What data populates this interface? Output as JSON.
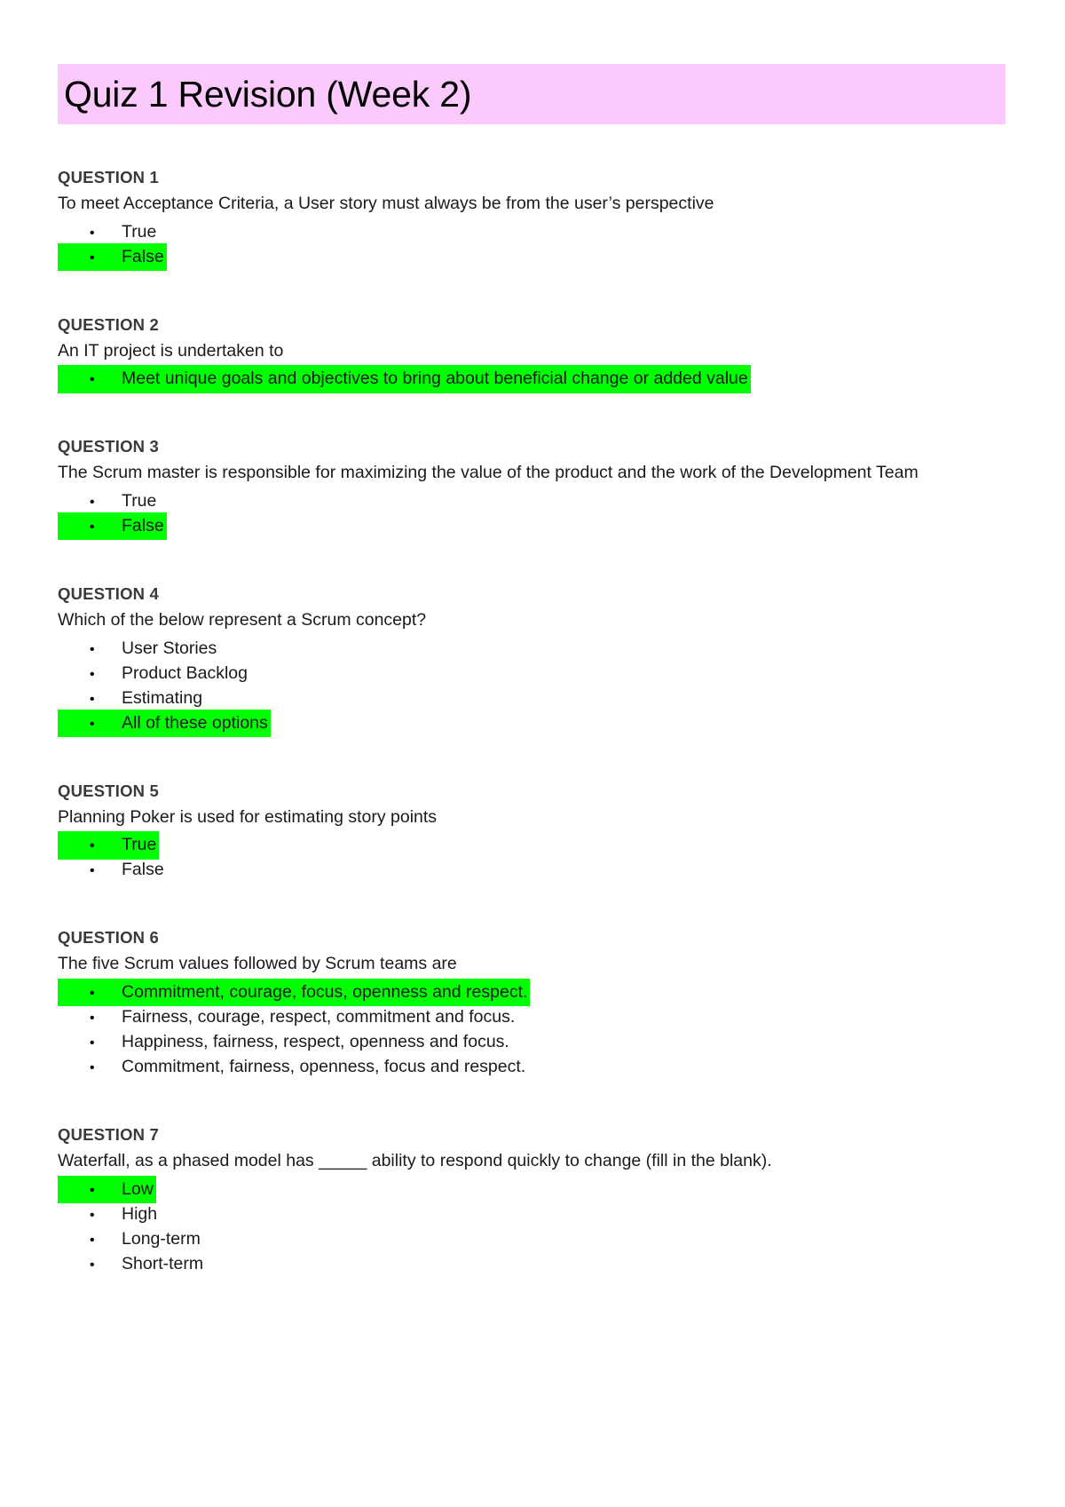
{
  "document": {
    "title": "Quiz 1 Revision (Week 2)",
    "title_highlight_color": "#fcc9fc",
    "answer_highlight_color": "#00ff00",
    "bullet_glyph": "•"
  },
  "questions": [
    {
      "header": "QUESTION 1",
      "text": "To meet Acceptance Criteria, a User story must always be from the user’s perspective",
      "options": [
        {
          "label": "True",
          "highlighted": false
        },
        {
          "label": "False",
          "highlighted": true
        }
      ]
    },
    {
      "header": "QUESTION 2",
      "text": "An IT project is undertaken to",
      "options": [
        {
          "label": "Meet unique goals and objectives to bring about beneficial change or added value",
          "highlighted": true
        }
      ]
    },
    {
      "header": "QUESTION 3",
      "text": "The Scrum master is responsible for maximizing the value of the product and the work of the Development Team",
      "options": [
        {
          "label": "True",
          "highlighted": false
        },
        {
          "label": "False",
          "highlighted": true
        }
      ]
    },
    {
      "header": "QUESTION 4",
      "text": "Which of the below represent a Scrum concept?",
      "options": [
        {
          "label": "User Stories",
          "highlighted": false
        },
        {
          "label": "Product Backlog",
          "highlighted": false
        },
        {
          "label": "Estimating",
          "highlighted": false
        },
        {
          "label": "All of these options",
          "highlighted": true
        }
      ]
    },
    {
      "header": "QUESTION 5",
      "text": "Planning Poker is used for estimating story points",
      "options": [
        {
          "label": "True",
          "highlighted": true
        },
        {
          "label": "False",
          "highlighted": false
        }
      ]
    },
    {
      "header": "QUESTION 6",
      "text": "The five Scrum values followed by Scrum teams are",
      "options": [
        {
          "label": "Commitment, courage, focus, openness and respect.",
          "highlighted": true
        },
        {
          "label": "Fairness, courage, respect, commitment and focus.",
          "highlighted": false
        },
        {
          "label": "Happiness, fairness, respect, openness and focus.",
          "highlighted": false
        },
        {
          "label": "Commitment, fairness, openness, focus and respect.",
          "highlighted": false
        }
      ]
    },
    {
      "header": "QUESTION 7",
      "text": "Waterfall, as a phased model has _____ ability to respond quickly to change (fill in the blank).",
      "options": [
        {
          "label": "Low",
          "highlighted": true
        },
        {
          "label": "High",
          "highlighted": false
        },
        {
          "label": "Long-term",
          "highlighted": false
        },
        {
          "label": "Short-term",
          "highlighted": false
        }
      ]
    }
  ]
}
